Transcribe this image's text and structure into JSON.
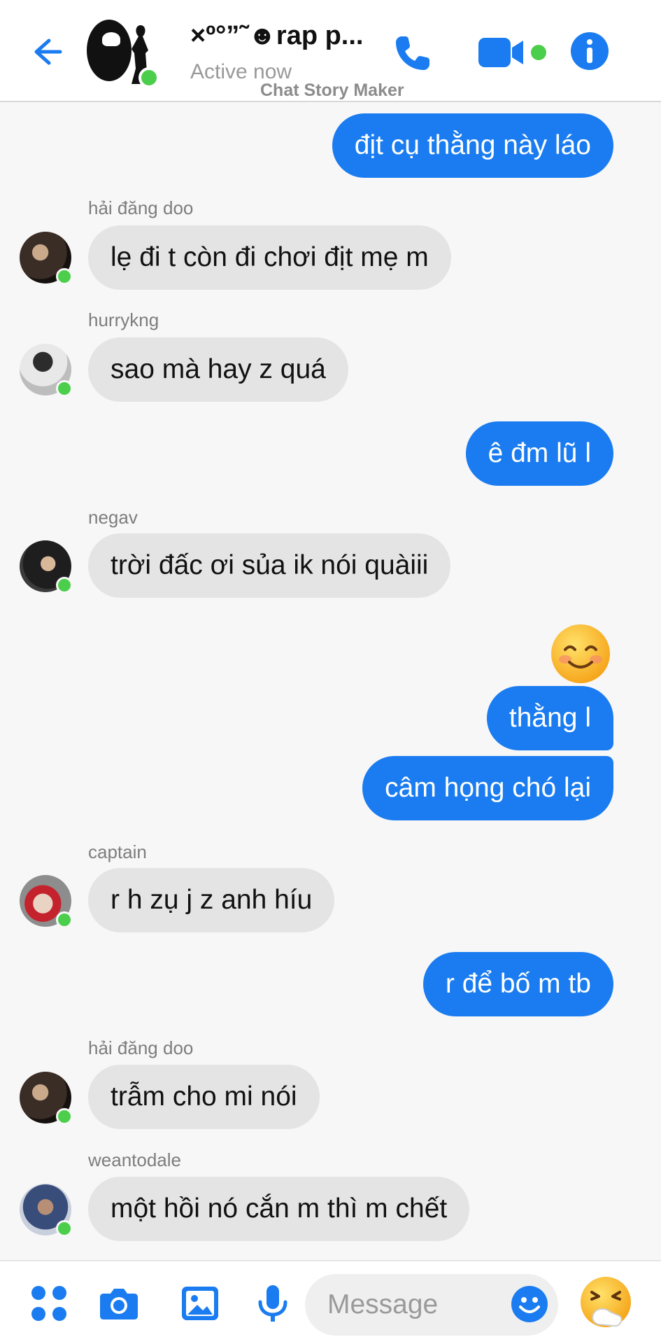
{
  "header": {
    "title": "×º°”˜☻rap p...",
    "status": "Active now",
    "watermark": "Chat Story Maker",
    "icons": [
      "back-arrow-icon",
      "phone-icon",
      "video-camera-icon",
      "info-icon"
    ]
  },
  "messages": [
    {
      "direction": "out",
      "text": "địt cụ thằng này láo"
    },
    {
      "direction": "in",
      "sender": "hải đăng doo",
      "text": "lẹ đi t còn đi chơi địt mẹ m"
    },
    {
      "direction": "in",
      "sender": "hurrykng",
      "text": "sao mà hay z quá"
    },
    {
      "direction": "out",
      "text": "ê đm lũ l"
    },
    {
      "direction": "in",
      "sender": "negav",
      "text": "trời đấc ơi sủa ik nói quàiii"
    },
    {
      "direction": "out",
      "emoji": "smiling-face-emoji"
    },
    {
      "direction": "out",
      "text": "thằng l"
    },
    {
      "direction": "out",
      "text": "câm họng chó lại"
    },
    {
      "direction": "in",
      "sender": "captain",
      "text": "r h zụ j z anh híu"
    },
    {
      "direction": "out",
      "text": "r để bố m tb"
    },
    {
      "direction": "in",
      "sender": "hải đăng doo",
      "text": "trẫm cho mi nói"
    },
    {
      "direction": "in",
      "sender": "weantodale",
      "text": "một hồi nó cắn m thì m chết"
    }
  ],
  "composer": {
    "placeholder": "Message",
    "icons": [
      "apps-grid-icon",
      "camera-icon",
      "image-icon",
      "microphone-icon",
      "emoji-icon",
      "sneezing-face-icon"
    ]
  },
  "colors": {
    "accent": "#1a7cf0",
    "online": "#4bce4b",
    "incoming_bubble": "#e4e4e4",
    "background": "#f7f7f7"
  }
}
